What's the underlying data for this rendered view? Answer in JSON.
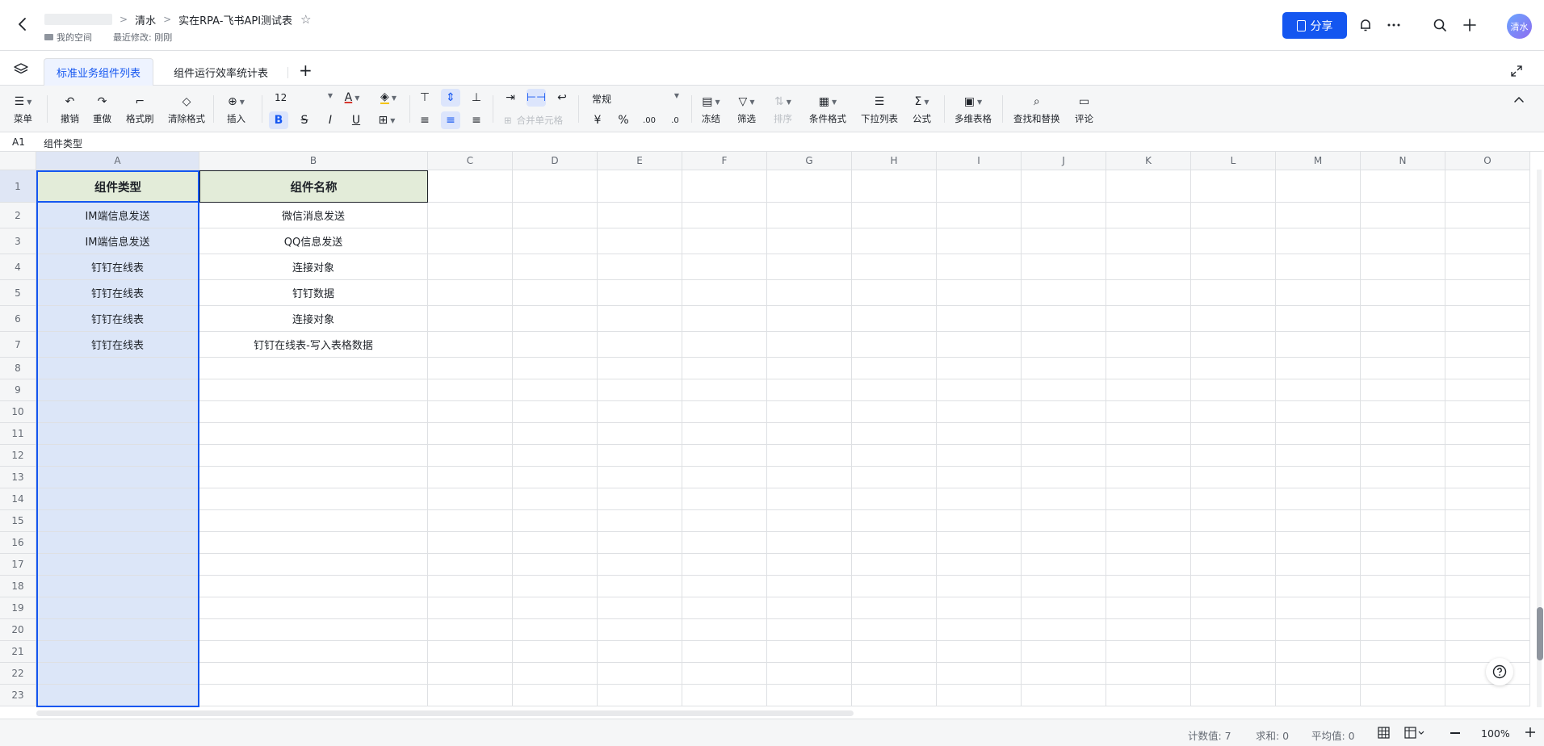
{
  "header": {
    "breadcrumb_parent": "清水",
    "doc_title": "实在RPA-飞书API测试表",
    "location": "我的空间",
    "last_modified": "最近修改: 刚刚",
    "share_label": "分享",
    "avatar_text": "清水"
  },
  "tabs": [
    {
      "label": "标准业务组件列表",
      "active": true
    },
    {
      "label": "组件运行效率统计表",
      "active": false
    }
  ],
  "toolbar": {
    "menu": "菜单",
    "undo": "撤销",
    "redo": "重做",
    "format_painter": "格式刷",
    "clear_format": "清除格式",
    "insert": "插入",
    "font_size": "12",
    "merge_cells": "合并单元格",
    "number_format": "常规",
    "freeze": "冻结",
    "filter": "筛选",
    "sort": "排序",
    "conditional_format": "条件格式",
    "dropdown_list": "下拉列表",
    "formula": "公式",
    "multi_table": "多维表格",
    "find_replace": "查找和替换",
    "comment": "评论"
  },
  "formula_bar": {
    "cell_ref": "A1",
    "content": "组件类型"
  },
  "sheet": {
    "columns": [
      "A",
      "B",
      "C",
      "D",
      "E",
      "F",
      "G",
      "H",
      "I",
      "J",
      "K",
      "L",
      "M",
      "N",
      "O"
    ],
    "header_row": [
      "组件类型",
      "组件名称"
    ],
    "rows": [
      [
        "IM端信息发送",
        "微信消息发送"
      ],
      [
        "IM端信息发送",
        "QQ信息发送"
      ],
      [
        "钉钉在线表",
        "连接对象"
      ],
      [
        "钉钉在线表",
        "钉钉数据"
      ],
      [
        "钉钉在线表",
        "连接对象"
      ],
      [
        "钉钉在线表",
        "钉钉在线表-写入表格数据"
      ]
    ],
    "row_numbers": [
      "1",
      "2",
      "3",
      "4",
      "5",
      "6",
      "7",
      "8",
      "9",
      "10",
      "11",
      "12",
      "13",
      "14",
      "15",
      "16",
      "17",
      "18",
      "19",
      "20",
      "21",
      "22",
      "23"
    ],
    "header_fill_color": "#e3ecd9",
    "selection_color": "#1456f0"
  },
  "status": {
    "count": "计数值: 7",
    "sum": "求和: 0",
    "average": "平均值: 0",
    "zoom": "100%"
  }
}
